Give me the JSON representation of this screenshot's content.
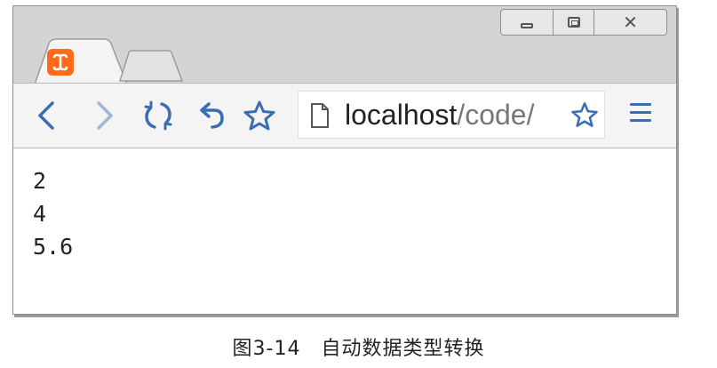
{
  "browser": {
    "url_host": "localhost",
    "url_path": "/code/",
    "icons": {
      "back": "back-arrow-icon",
      "forward": "forward-arrow-icon",
      "reload": "reload-icon",
      "undo": "undo-icon",
      "bookmark": "star-icon",
      "menu": "hamburger-menu-icon",
      "favicon": "xampp-favicon-icon",
      "page": "page-document-icon"
    },
    "window_controls": [
      "minimize",
      "maximize",
      "close"
    ]
  },
  "output": {
    "lines": [
      "2",
      "4",
      "5.6"
    ]
  },
  "caption": "图3-14　自动数据类型转换",
  "colors": {
    "accent": "#3b6db5",
    "favicon": "#ff6b1a"
  }
}
